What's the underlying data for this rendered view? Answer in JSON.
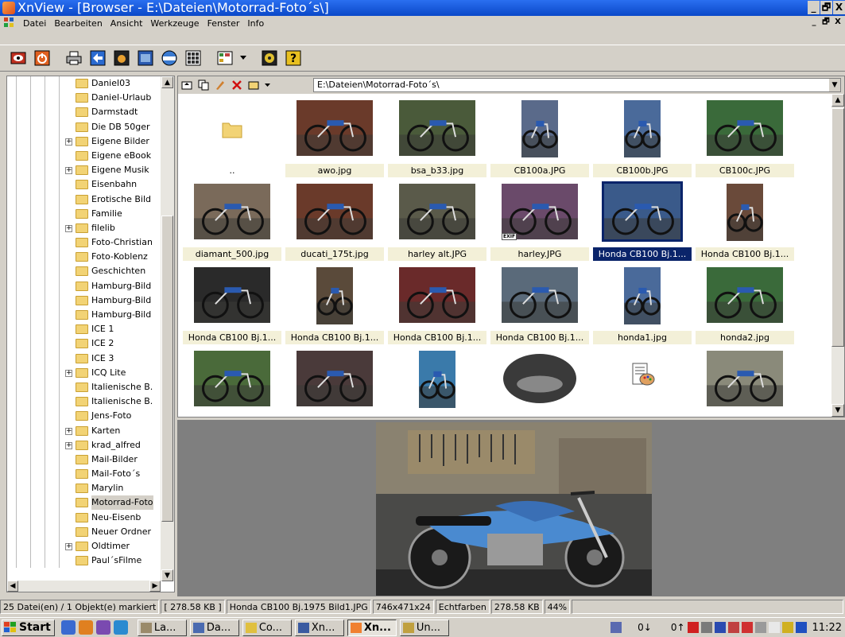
{
  "window": {
    "title": "XnView - [Browser - E:\\Dateien\\Motorrad-Foto´s\\]",
    "min": "_",
    "restore": "🗗",
    "close": "X"
  },
  "menus": [
    "Datei",
    "Bearbeiten",
    "Ansicht",
    "Werkzeuge",
    "Fenster",
    "Info"
  ],
  "tree": {
    "items": [
      {
        "label": "Daniel03",
        "exp": false
      },
      {
        "label": "Daniel-Urlaub",
        "exp": false
      },
      {
        "label": "Darmstadt",
        "exp": false
      },
      {
        "label": "Die DB 50ger",
        "exp": false
      },
      {
        "label": "Eigene Bilder",
        "exp": true
      },
      {
        "label": "Eigene eBook",
        "exp": false
      },
      {
        "label": "Eigene Musik",
        "exp": true
      },
      {
        "label": "Eisenbahn",
        "exp": false
      },
      {
        "label": "Erotische Bild",
        "exp": false
      },
      {
        "label": "Familie",
        "exp": false
      },
      {
        "label": "filelib",
        "exp": true
      },
      {
        "label": "Foto-Christian",
        "exp": false
      },
      {
        "label": "Foto-Koblenz",
        "exp": false
      },
      {
        "label": "Geschichten",
        "exp": false
      },
      {
        "label": "Hamburg-Bild",
        "exp": false
      },
      {
        "label": "Hamburg-Bild",
        "exp": false
      },
      {
        "label": "Hamburg-Bild",
        "exp": false
      },
      {
        "label": "ICE 1",
        "exp": false
      },
      {
        "label": "ICE 2",
        "exp": false
      },
      {
        "label": "ICE 3",
        "exp": false
      },
      {
        "label": "ICQ Lite",
        "exp": true
      },
      {
        "label": "Italienische B.",
        "exp": false
      },
      {
        "label": "Italienische B.",
        "exp": false
      },
      {
        "label": "Jens-Foto",
        "exp": false
      },
      {
        "label": "Karten",
        "exp": true
      },
      {
        "label": "krad_alfred",
        "exp": true
      },
      {
        "label": "Mail-Bilder",
        "exp": false
      },
      {
        "label": "Mail-Foto´s",
        "exp": false
      },
      {
        "label": "Marylin",
        "exp": false
      },
      {
        "label": "Motorrad-Foto",
        "exp": false,
        "selected": true
      },
      {
        "label": "Neu-Eisenb",
        "exp": false
      },
      {
        "label": "Neuer Ordner",
        "exp": false
      },
      {
        "label": "Oldtimer",
        "exp": true
      },
      {
        "label": "Paul´sFilme",
        "exp": false
      }
    ]
  },
  "browser": {
    "path": "E:\\Dateien\\Motorrad-Foto´s\\",
    "files": [
      {
        "name": "..",
        "kind": "updir"
      },
      {
        "name": "awo.jpg",
        "kind": "photo",
        "tone": "#6a3a2a"
      },
      {
        "name": "bsa_b33.jpg",
        "kind": "photo",
        "tone": "#4a5a3a"
      },
      {
        "name": "CB100a.JPG",
        "kind": "photo",
        "tone": "#5a6a8a",
        "portrait": true
      },
      {
        "name": "CB100b.JPG",
        "kind": "photo",
        "tone": "#4a6a9a",
        "portrait": true
      },
      {
        "name": "CB100c.JPG",
        "kind": "photo",
        "tone": "#3a6a3a"
      },
      {
        "name": "diamant_500.jpg",
        "kind": "photo",
        "tone": "#7a6a5a"
      },
      {
        "name": "ducati_175t.jpg",
        "kind": "photo",
        "tone": "#6a3a2a"
      },
      {
        "name": "harley alt.JPG",
        "kind": "photo",
        "tone": "#5a5a4a"
      },
      {
        "name": "harley.JPG",
        "kind": "photo",
        "tone": "#6a4a6a",
        "exif": "EXIF"
      },
      {
        "name": "Honda CB100 Bj.1...",
        "kind": "photo",
        "tone": "#3a5a8a",
        "selected": true
      },
      {
        "name": "Honda CB100 Bj.1...",
        "kind": "photo",
        "tone": "#6a4a3a",
        "portrait": true
      },
      {
        "name": "Honda CB100 Bj.1...",
        "kind": "photo",
        "tone": "#2a2a2a"
      },
      {
        "name": "Honda CB100 Bj.1...",
        "kind": "photo",
        "tone": "#5a4a3a",
        "portrait": true
      },
      {
        "name": "Honda CB100 Bj.1...",
        "kind": "photo",
        "tone": "#6a2a2a"
      },
      {
        "name": "Honda CB100 Bj.1...",
        "kind": "photo",
        "tone": "#5a6a7a"
      },
      {
        "name": "honda1.jpg",
        "kind": "photo",
        "tone": "#4a6a9a",
        "portrait": true
      },
      {
        "name": "honda2.jpg",
        "kind": "photo",
        "tone": "#3a6a3a"
      },
      {
        "name": "",
        "kind": "photo",
        "tone": "#4a6a3a"
      },
      {
        "name": "",
        "kind": "photo",
        "tone": "#4a3a3a"
      },
      {
        "name": "",
        "kind": "photo",
        "tone": "#3a7aaa",
        "portrait": true
      },
      {
        "name": "",
        "kind": "photo",
        "tone": "#3a3a3a",
        "oval": true
      },
      {
        "name": "",
        "kind": "palette"
      },
      {
        "name": "",
        "kind": "photo",
        "tone": "#8a8a7a"
      }
    ]
  },
  "status": {
    "count": "25 Datei(en) / 1 Objekt(e) markiert",
    "total": "[ 278.58 KB ]",
    "file": "Honda CB100 Bj.1975 Bild1.JPG",
    "dims": "746x471x24",
    "color": "Echtfarben",
    "size": "278.58 KB",
    "zoom": "44%"
  },
  "taskbar": {
    "start": "Start",
    "buttons": [
      {
        "label": "La...",
        "color": "#9a8a6a"
      },
      {
        "label": "Da...",
        "color": "#4a6ab0"
      },
      {
        "label": "Co...",
        "color": "#e0c040"
      },
      {
        "label": "Xn...",
        "color": "#3a5aa0"
      },
      {
        "label": "Xn...",
        "color": "#f08030",
        "active": true
      },
      {
        "label": "Un...",
        "color": "#c0a040"
      }
    ],
    "net1": "0↓",
    "net2": "0↑",
    "clock": "11:22"
  },
  "colors": {
    "title": "#0a48c8",
    "selection": "#0a246a"
  }
}
